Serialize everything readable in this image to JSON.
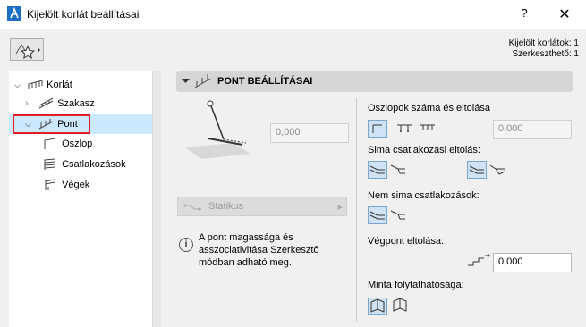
{
  "window": {
    "title": "Kijelölt korlát beállításai",
    "help": "?",
    "close": "✕"
  },
  "selection_info": {
    "line1": "Kijelölt korlátok: 1",
    "line2": "Szerkeszthető: 1"
  },
  "tree": {
    "items": [
      {
        "label": "Korlát"
      },
      {
        "label": "Szakasz"
      },
      {
        "label": "Pont"
      },
      {
        "label": "Oszlop"
      },
      {
        "label": "Csatlakozások"
      },
      {
        "label": "Végek"
      }
    ]
  },
  "panel": {
    "title": "PONT BEÁLLÍTÁSAI",
    "point_value": "0,000",
    "static_label": "Statikus",
    "info_text": "A pont magassága és asszociativitása Szerkesztő módban adható meg.",
    "posts": {
      "label": "Oszlopok száma és eltolása",
      "value": "0,000"
    },
    "smooth_offset": {
      "label": "Sima csatlakozási eltolás:"
    },
    "nonsmooth_offset": {
      "label": "Nem sima csatlakozások:"
    },
    "end_offset": {
      "label": "Végpont eltolása:",
      "value": "0,000"
    },
    "pattern_continuity": {
      "label": "Minta folytathatósága:"
    }
  }
}
